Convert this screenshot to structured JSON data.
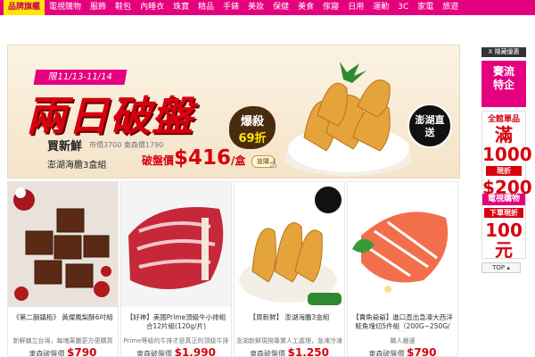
{
  "nav": {
    "items": [
      "品牌旗艦",
      "電視購物",
      "服飾",
      "鞋包",
      "內睡衣",
      "珠寶",
      "精品",
      "手錶",
      "美妝",
      "保健",
      "美食",
      "傢寢",
      "日用",
      "運動",
      "3C",
      "家電",
      "旅遊"
    ],
    "active_index": 0
  },
  "banner": {
    "date_range": "限11/13-11/14",
    "headline": "兩日破盤",
    "discount_line1": "爆殺",
    "discount_line2": "69折",
    "seller": "買新鮮",
    "market_price": "市價3700 東森價1790",
    "bundle": "澎湖海膽3盒組",
    "sale_prefix": "破盤價",
    "sale_price": "$416",
    "sale_unit": "/盒",
    "grab_button": "搶購",
    "seal_text": "澎湖直送"
  },
  "products": [
    {
      "title": "《第二韻鎮栢》\n黃燦鳳梨酥6吋組",
      "desc": "新鮮鎮立台灣，每塊果麗更方便購買",
      "price_label": "東森破盤價",
      "price": "$790",
      "image": "brown-sugar-cubes"
    },
    {
      "title": "【好神】美國Prime頂級牛小排組合12片組(120g/片)",
      "desc": "Prime等級的牛排才是真正的頂級牛排",
      "price_label": "東森破盤價",
      "price": "$1,990",
      "image": "raw-beef-short-rib"
    },
    {
      "title": "【買新鮮】\n澎湖海膽3盒組",
      "desc": "澎湖新鮮現撈專業人工處理，急凍冷凍",
      "price_label": "東森破盤價",
      "price": "$1,250",
      "image": "sea-urchin-bowl"
    },
    {
      "title": "【賣魚爺爺】進口直出急凍大西洋鮭魚塊切5件組（200G~250G/件）",
      "desc": "職人嚴選",
      "price_label": "東森破盤價",
      "price": "$790",
      "image": "salmon-fillet"
    }
  ],
  "sidebar": {
    "header": "X 隱藏優惠",
    "block1": [
      "賽流",
      "特企"
    ],
    "block2_line1": "全館單品",
    "block2_line2": "滿1000",
    "block2_tag": "現折",
    "block2_big": "$200",
    "block3_header": "電視購物",
    "block3_sub": "下單現折",
    "block3_big": "100元",
    "top_button": "TOP ▴"
  },
  "colors": {
    "brand": "#e4007f",
    "accent_red": "#d8000f",
    "nav_active": "#ffe600"
  }
}
